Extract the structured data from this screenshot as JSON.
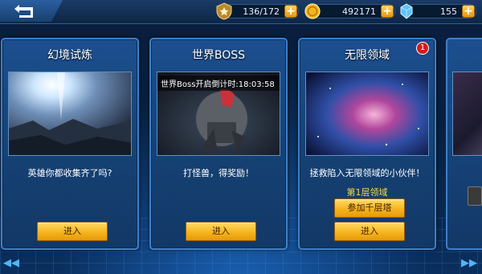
{
  "topbar": {
    "resources": [
      {
        "name": "stamina",
        "value": "136/172",
        "icon": "shield-medal-icon"
      },
      {
        "name": "gold",
        "value": "492171",
        "icon": "gold-coin-icon"
      },
      {
        "name": "diamond",
        "value": "155",
        "icon": "diamond-icon"
      }
    ]
  },
  "cards": [
    {
      "title": "幻境试炼",
      "desc": "英雄你都收集齐了吗?",
      "button": "进入"
    },
    {
      "title": "世界BOSS",
      "timer": "世界Boss开启倒计时:18:03:58",
      "desc": "打怪兽，得奖励！",
      "button": "进入"
    },
    {
      "title": "无限领域",
      "badge": "1",
      "desc": "拯救陷入无限领域的小伙伴！",
      "floor": "第1层领域",
      "button_tower": "参加千层塔",
      "button": "进入"
    }
  ],
  "colors": {
    "accent_gold": "#f6b41d",
    "panel_blue": "#1c4f8f",
    "floor_text": "#ffd54a"
  }
}
